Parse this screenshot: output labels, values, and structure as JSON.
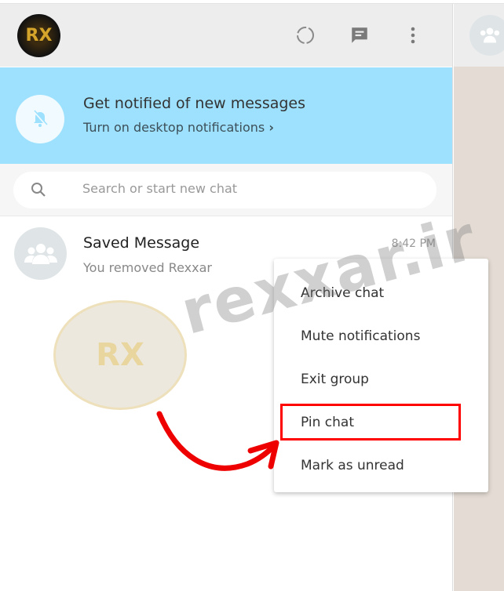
{
  "header": {
    "avatar_text": "RX",
    "icons": [
      "status-icon",
      "new-chat-icon",
      "menu-icon"
    ]
  },
  "banner": {
    "title": "Get notified of new messages",
    "subtitle": "Turn on desktop notifications",
    "chevron": "›"
  },
  "search": {
    "placeholder": "Search or start new chat",
    "value": ""
  },
  "chats": [
    {
      "name": "Saved Message",
      "time": "8:42 PM",
      "last_message": "You removed Rexxar"
    }
  ],
  "context_menu": {
    "items": [
      {
        "label": "Archive chat"
      },
      {
        "label": "Mute notifications"
      },
      {
        "label": "Exit group"
      },
      {
        "label": "Pin chat",
        "highlighted": true
      },
      {
        "label": "Mark as unread"
      }
    ]
  },
  "watermark": {
    "text": "rexxar.ir"
  },
  "colors": {
    "banner": "#9de1fe",
    "highlight": "#ff0000",
    "header": "#ededed"
  }
}
